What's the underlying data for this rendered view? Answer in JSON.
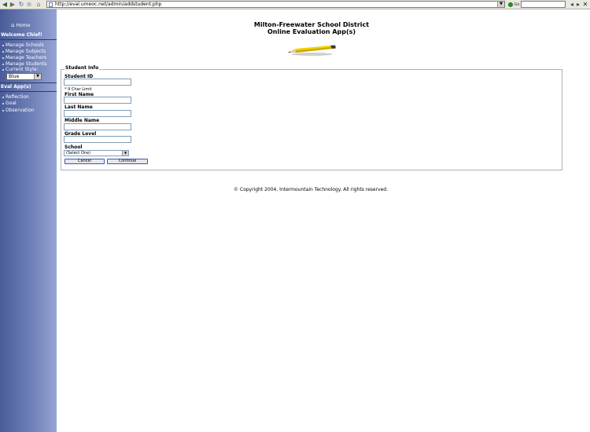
{
  "browser": {
    "url": "http://eval.umeoc.net/admin/addstudent.php"
  },
  "sidebar": {
    "home": "Home",
    "welcome": "Welcome Chief!",
    "manage_items": [
      "Manage Schools",
      "Manage Subjects",
      "Manage Teachers",
      "Manage Students",
      "Current Style:"
    ],
    "style_value": "Blue",
    "eval_heading": "Eval App(s)",
    "eval_items": [
      "Reflection",
      "Goal",
      "Observation"
    ]
  },
  "header": {
    "line1": "Milton-Freewater School District",
    "line2": "Online Evaluation App(s)"
  },
  "form": {
    "legend": "Student Info",
    "student_id_label": "Student ID",
    "char_limit": "* 9 Char Limit",
    "first_name_label": "First Name",
    "last_name_label": "Last Name",
    "middle_name_label": "Middle Name",
    "grade_level_label": "Grade Level",
    "school_label": "School",
    "school_value": "(Select One)",
    "cancel_label": "Cancel",
    "continue_label": "Continue"
  },
  "footer": {
    "copyright": "© Copyright 2004. Intermountain Technology. All rights reserved."
  },
  "colors": {
    "sidebar_dark": "#4a5c98",
    "sidebar_light": "#95a4d3",
    "button_border": "#3d5aa6",
    "pencil_yellow": "#f0d400"
  }
}
